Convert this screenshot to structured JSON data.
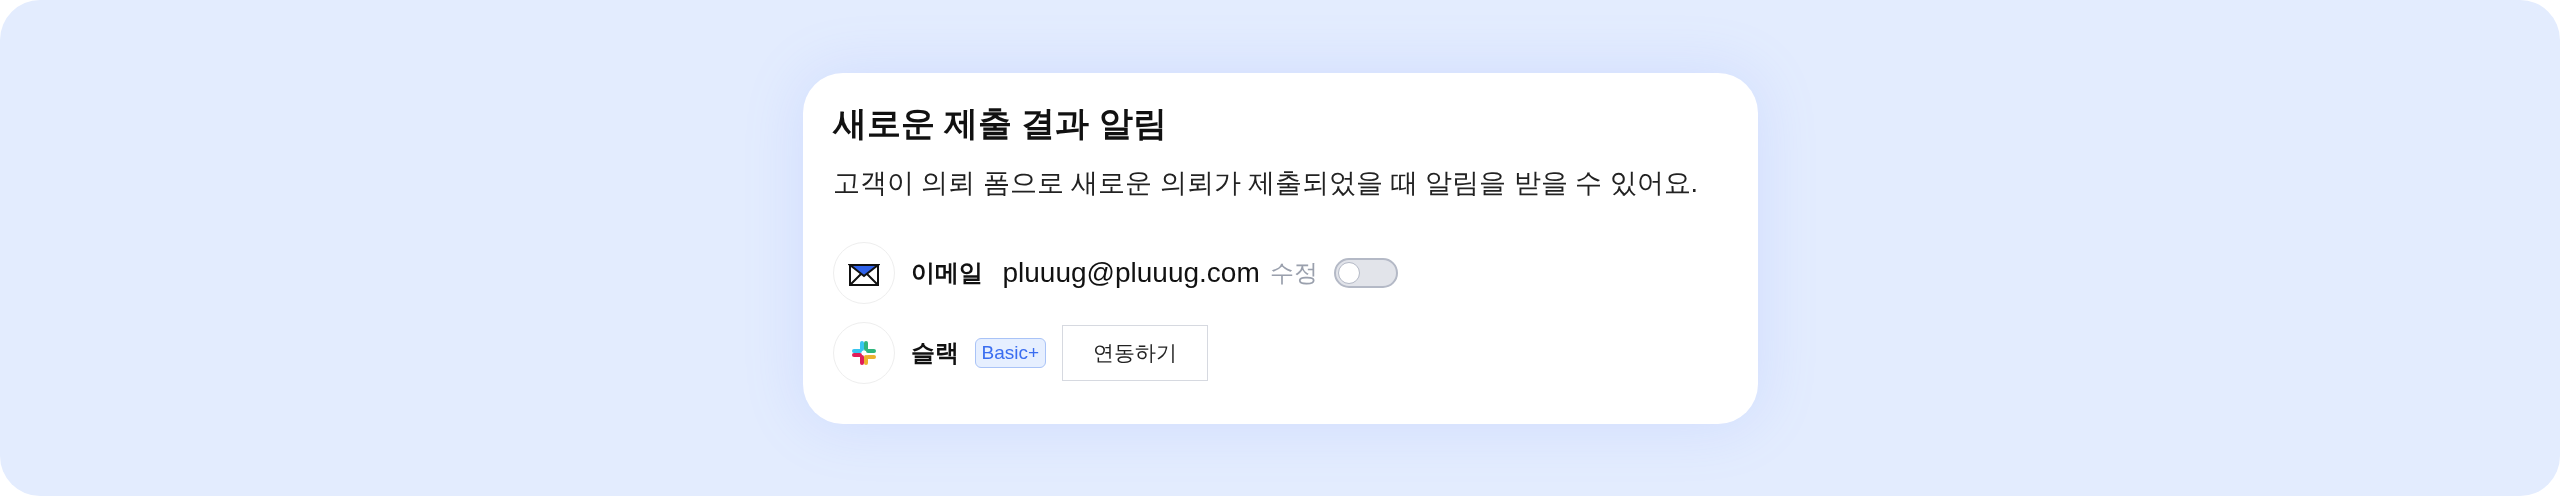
{
  "card": {
    "title": "새로운 제출 결과 알림",
    "description": "고객이 의뢰 폼으로 새로운 의뢰가 제출되었을 때 알림을 받을 수 있어요."
  },
  "channels": [
    {
      "kind": "email",
      "label": "이메일",
      "address": "pluuug@pluuug.com",
      "edit": "수정",
      "on": false
    },
    {
      "kind": "slack",
      "label": "슬랙",
      "badge": "Basic+",
      "action": "연동하기"
    }
  ]
}
